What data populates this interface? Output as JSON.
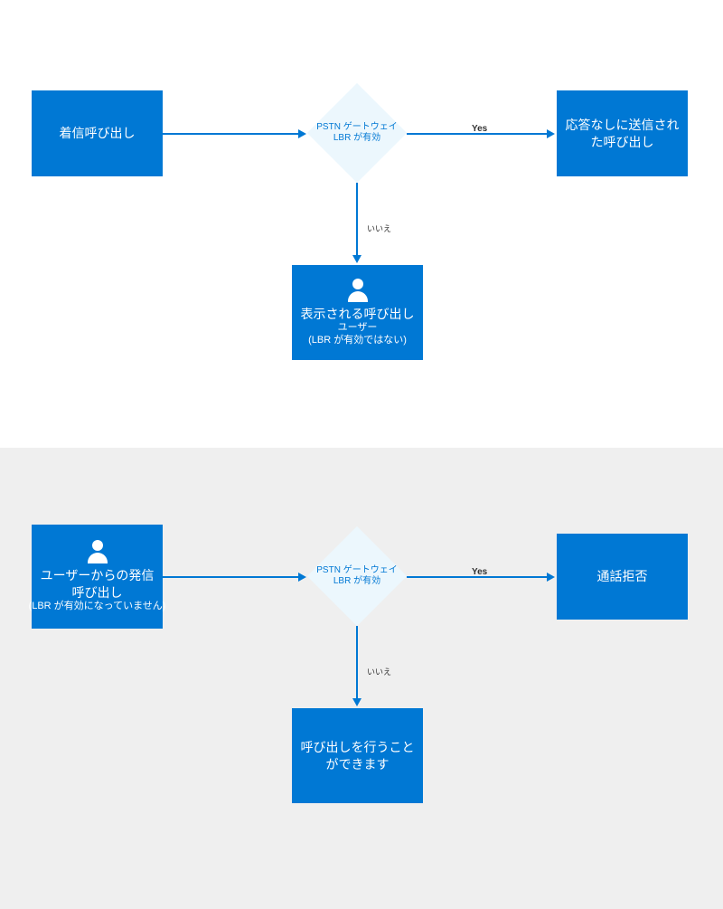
{
  "colors": {
    "primary": "#0078d4",
    "diamond_bg": "#ecf7fd",
    "panel_bottom_bg": "#efefef"
  },
  "top": {
    "start": "着信呼び出し",
    "decision": "PSTN ゲートウェイ LBR が有効",
    "yes_label": "Yes",
    "no_label": "いいえ",
    "yes_result": "応答なしに送信された呼び出し",
    "no_result_title": "表示される呼び出し",
    "no_result_sub1": "ユーザー",
    "no_result_sub2": "(LBR が有効ではない)"
  },
  "bottom": {
    "start_title": "ユーザーからの発信呼び出し",
    "start_sub": "(LBR が有効になっていません)",
    "decision": "PSTN ゲートウェイ LBR が有効",
    "yes_label": "Yes",
    "no_label": "いいえ",
    "yes_result": "通話拒否",
    "no_result": "呼び出しを行うことができます"
  }
}
